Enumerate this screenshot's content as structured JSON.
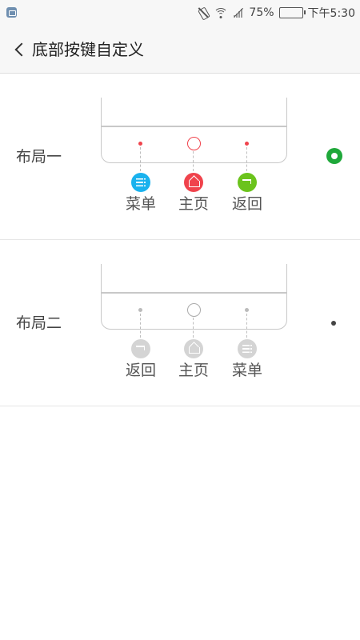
{
  "status_bar": {
    "battery_percent": "75%",
    "battery_level": 0.75,
    "time": "下午5:30",
    "icons": [
      "app-notification-icon",
      "vibrate-off-icon",
      "wifi-icon",
      "signal-icon",
      "battery-icon"
    ]
  },
  "header": {
    "back_icon": "chevron-left-icon",
    "title": "底部按键自定义"
  },
  "layouts": [
    {
      "label": "布局一",
      "selected": true,
      "keys": [
        {
          "label": "菜单",
          "icon": "menu-icon",
          "color": "#1ab2ee"
        },
        {
          "label": "主页",
          "icon": "home-icon",
          "color": "#f0434c"
        },
        {
          "label": "返回",
          "icon": "back-icon",
          "color": "#6bc31c"
        }
      ],
      "indicator_color": "#f0434c"
    },
    {
      "label": "布局二",
      "selected": false,
      "keys": [
        {
          "label": "返回",
          "icon": "back-icon",
          "color": "#d4d4d4"
        },
        {
          "label": "主页",
          "icon": "home-icon",
          "color": "#d4d4d4"
        },
        {
          "label": "菜单",
          "icon": "menu-icon",
          "color": "#d4d4d4"
        }
      ],
      "indicator_color": "#bbbbbb"
    }
  ],
  "colors": {
    "radio_selected": "#1fa83a",
    "header_bg": "#f7f7f7"
  }
}
